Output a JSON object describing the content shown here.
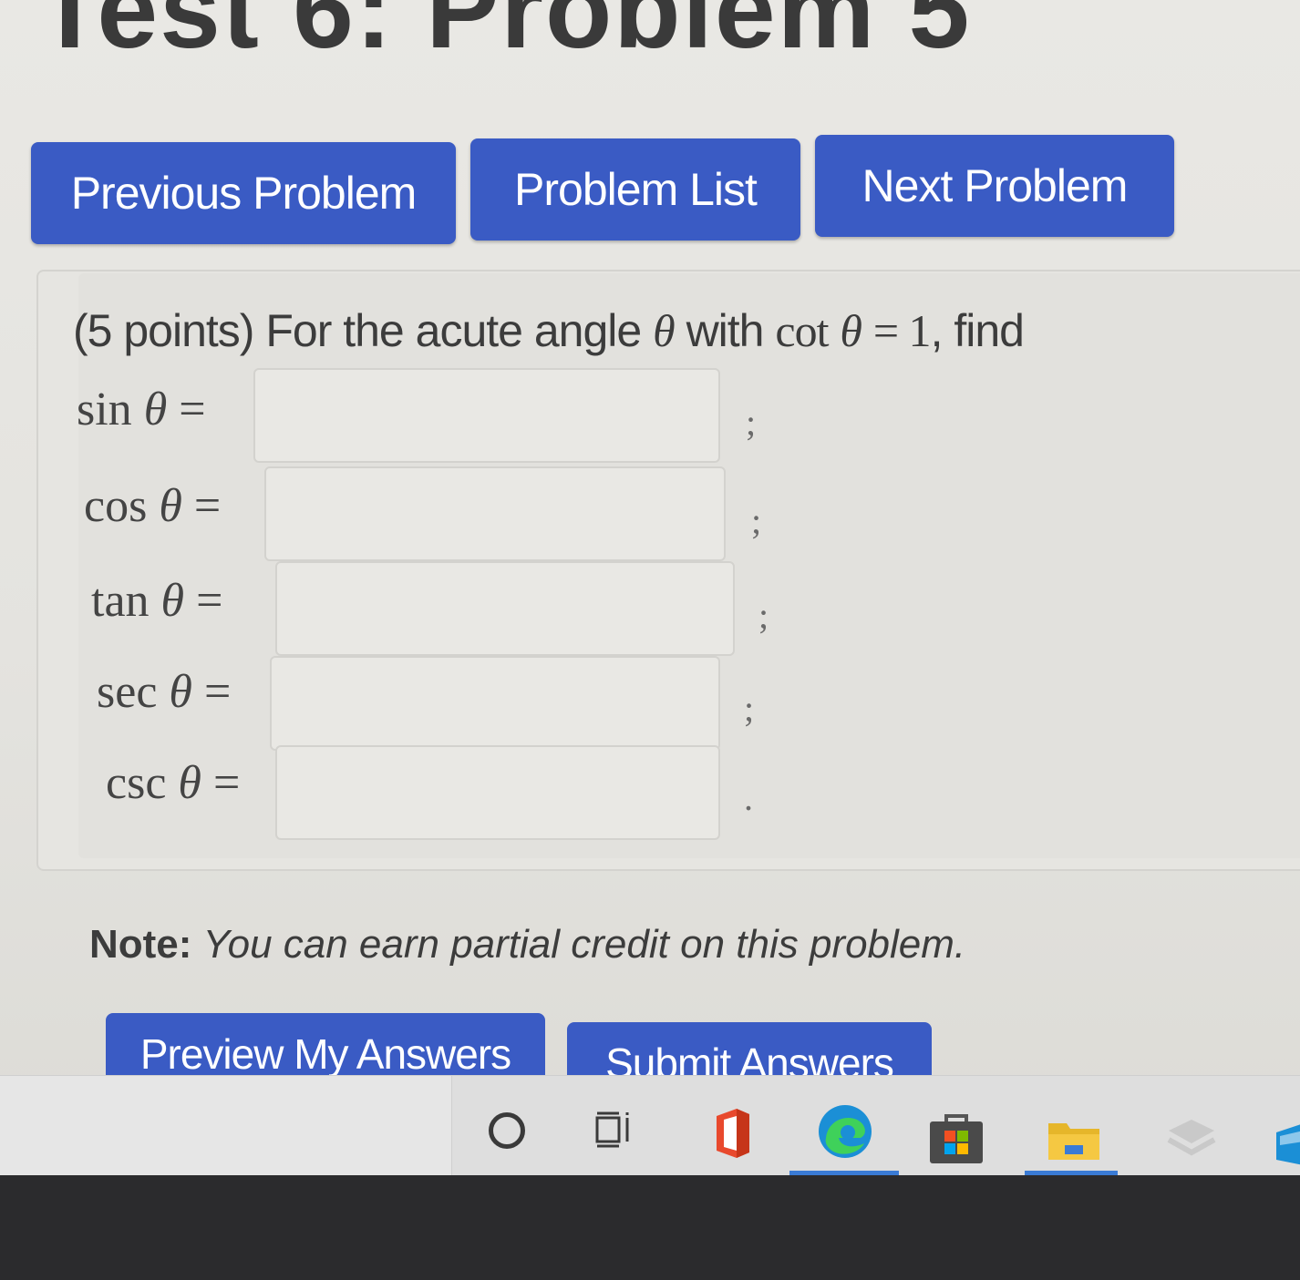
{
  "page": {
    "title": "Test 6: Problem 5"
  },
  "nav": {
    "previous_label": "Previous Problem",
    "list_label": "Problem List",
    "next_label": "Next Problem"
  },
  "problem": {
    "points": "(5 points)",
    "prompt_text": "For the acute angle",
    "theta": "θ",
    "with": "with",
    "cot": "cot",
    "equals_one": "= 1",
    "find": ", find",
    "rows": [
      {
        "func": "sin",
        "theta": "θ",
        "eq": "=",
        "value": "",
        "punct": ";"
      },
      {
        "func": "cos",
        "theta": "θ",
        "eq": "=",
        "value": "",
        "punct": ";"
      },
      {
        "func": "tan",
        "theta": "θ",
        "eq": "=",
        "value": "",
        "punct": ";"
      },
      {
        "func": "sec",
        "theta": "θ",
        "eq": "=",
        "value": "",
        "punct": ";"
      },
      {
        "func": "csc",
        "theta": "θ",
        "eq": "=",
        "value": "",
        "punct": "."
      }
    ]
  },
  "note": {
    "label": "Note:",
    "text": "You can earn partial credit on this problem."
  },
  "actions": {
    "preview_label": "Preview My Answers",
    "submit_label": "Submit Answers"
  },
  "taskbar": {
    "icons": [
      "search-circle-icon",
      "taskview-icon",
      "office-icon",
      "edge-icon",
      "store-icon",
      "explorer-icon",
      "misc-icon",
      "edge-right-icon"
    ],
    "accent_color": "#3a7bd5"
  },
  "colors": {
    "button_bg": "#3a5bc4",
    "button_text": "#ffffff",
    "page_bg": "#e9e8e4"
  }
}
